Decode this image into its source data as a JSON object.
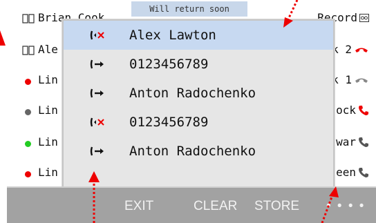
{
  "status": {
    "text": "Will return soon"
  },
  "contacts": [
    {
      "name": "Brian Cook",
      "right": "Record",
      "left_icon": "book-icon",
      "right_icon": "voicemail-icon"
    },
    {
      "name": "Ale",
      "right": "k 2",
      "left_icon": "book-icon",
      "right_icon": "phone-down-icon",
      "status_color": "#e00000"
    },
    {
      "name": "Lin",
      "right": "k 1",
      "left_icon": "presence-dot-red",
      "right_icon": "phone-idle-icon"
    },
    {
      "name": "Lin",
      "right": "ock",
      "left_icon": "presence-dot-grey",
      "right_icon": "phone-red-icon"
    },
    {
      "name": "Lin",
      "right": "war",
      "left_icon": "presence-dot-green",
      "right_icon": "phone-grey-icon"
    },
    {
      "name": "Lin",
      "right": "een",
      "left_icon": "presence-dot-red",
      "right_icon": "phone-grey-icon"
    }
  ],
  "call_list": [
    {
      "label": "Alex Lawton",
      "icon": "missed-call-icon",
      "selected": true
    },
    {
      "label": "0123456789",
      "icon": "outgoing-call-icon",
      "selected": false
    },
    {
      "label": "Anton Radochenko",
      "icon": "outgoing-call-icon",
      "selected": false
    },
    {
      "label": "0123456789",
      "icon": "missed-call-icon",
      "selected": false
    },
    {
      "label": "Anton Radochenko",
      "icon": "outgoing-call-icon",
      "selected": false
    }
  ],
  "softkeys": {
    "exit": "EXIT",
    "clear": "CLEAR",
    "store": "STORE",
    "more": "• • • •"
  },
  "colors": {
    "selection": "#c7d9f1",
    "softkey_bar": "#a2a2a2",
    "missed_call": "#e00000",
    "annotation": "#e00000"
  }
}
